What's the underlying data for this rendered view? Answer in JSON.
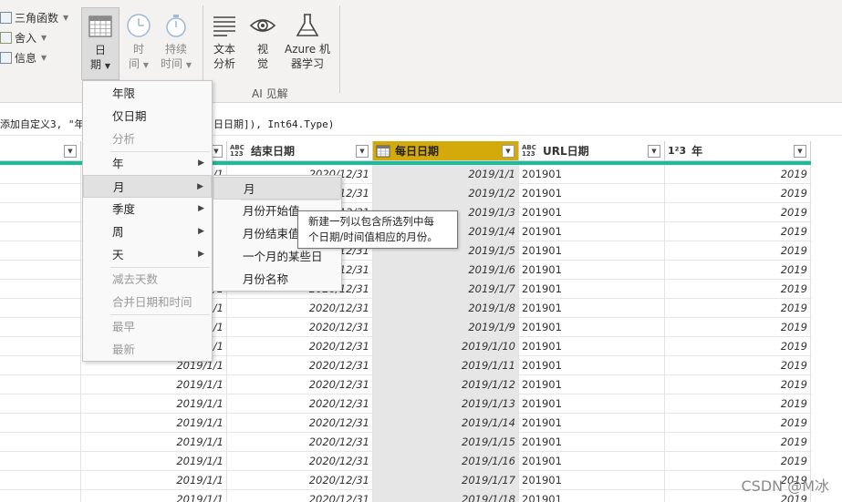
{
  "ribbon": {
    "small_buttons": [
      {
        "label": "三角函数",
        "icon": "trig-icon"
      },
      {
        "label": "舍入",
        "icon": "round-icon"
      },
      {
        "label": "信息",
        "icon": "info-icon"
      }
    ],
    "big_buttons": [
      {
        "label1": "日",
        "label2": "期",
        "icon": "calendar-icon",
        "active": true
      },
      {
        "label1": "时",
        "label2": "间",
        "icon": "clock-icon",
        "disabled": true
      },
      {
        "label1": "持续",
        "label2": "时间",
        "icon": "stopwatch-icon",
        "disabled": true
      },
      {
        "label1": "文本",
        "label2": "分析",
        "icon": "text-lines-icon"
      },
      {
        "label1": "视",
        "label2": "觉",
        "icon": "eye-icon"
      },
      {
        "label1": "Azure 机",
        "label2": "器学习",
        "icon": "flask-icon"
      }
    ],
    "group_label": "AI 见解"
  },
  "formula": {
    "part_a": "添加自定义3, \"年",
    "part_b": "日日期]), Int64.Type)"
  },
  "columns": [
    {
      "name": "",
      "type": ""
    },
    {
      "name": "",
      "type": ""
    },
    {
      "name": "结束日期",
      "type": "ABC\n123"
    },
    {
      "name": "每日日期",
      "type": "calendar"
    },
    {
      "name": "URL日期",
      "type": "ABC\n123"
    },
    {
      "name": "年",
      "type": "1²3"
    }
  ],
  "rows": [
    {
      "start": "2019/1/1",
      "end": "2020/12/31",
      "daily": "2019/1/1",
      "url": "201901",
      "year": "2019"
    },
    {
      "start": "2019/1/1",
      "end": "2020/12/31",
      "daily": "2019/1/2",
      "url": "201901",
      "year": "2019"
    },
    {
      "start": "2019/1/1",
      "end": "2020/12/31",
      "daily": "2019/1/3",
      "url": "201901",
      "year": "2019"
    },
    {
      "start": "2019/1/1",
      "end": "2020/12/31",
      "daily": "2019/1/4",
      "url": "201901",
      "year": "2019"
    },
    {
      "start": "2019/1/1",
      "end": "2020/12/31",
      "daily": "2019/1/5",
      "url": "201901",
      "year": "2019"
    },
    {
      "start": "2019/1/1",
      "end": "2020/12/31",
      "daily": "2019/1/6",
      "url": "201901",
      "year": "2019"
    },
    {
      "start": "2019/1/1",
      "end": "2020/12/31",
      "daily": "2019/1/7",
      "url": "201901",
      "year": "2019"
    },
    {
      "start": "2019/1/1",
      "end": "2020/12/31",
      "daily": "2019/1/8",
      "url": "201901",
      "year": "2019"
    },
    {
      "start": "2019/1/1",
      "end": "2020/12/31",
      "daily": "2019/1/9",
      "url": "201901",
      "year": "2019"
    },
    {
      "start": "2019/1/1",
      "end": "2020/12/31",
      "daily": "2019/1/10",
      "url": "201901",
      "year": "2019"
    },
    {
      "start": "2019/1/1",
      "end": "2020/12/31",
      "daily": "2019/1/11",
      "url": "201901",
      "year": "2019"
    },
    {
      "start": "2019/1/1",
      "end": "2020/12/31",
      "daily": "2019/1/12",
      "url": "201901",
      "year": "2019"
    },
    {
      "start": "2019/1/1",
      "end": "2020/12/31",
      "daily": "2019/1/13",
      "url": "201901",
      "year": "2019"
    },
    {
      "start": "2019/1/1",
      "end": "2020/12/31",
      "daily": "2019/1/14",
      "url": "201901",
      "year": "2019"
    },
    {
      "start": "2019/1/1",
      "end": "2020/12/31",
      "daily": "2019/1/15",
      "url": "201901",
      "year": "2019"
    },
    {
      "start": "2019/1/1",
      "end": "2020/12/31",
      "daily": "2019/1/16",
      "url": "201901",
      "year": "2019"
    },
    {
      "start": "2019/1/1",
      "end": "2020/12/31",
      "daily": "2019/1/17",
      "url": "201901",
      "year": "2019"
    },
    {
      "start": "2019/1/1",
      "end": "2020/12/31",
      "daily": "2019/1/18",
      "url": "201901",
      "year": "2019"
    }
  ],
  "date_menu": [
    {
      "label": "年限"
    },
    {
      "label": "仅日期"
    },
    {
      "label": "分析",
      "disabled": true
    },
    {
      "sep": true
    },
    {
      "label": "年",
      "submenu": true
    },
    {
      "label": "月",
      "submenu": true,
      "hover": true
    },
    {
      "label": "季度",
      "submenu": true
    },
    {
      "label": "周",
      "submenu": true
    },
    {
      "label": "天",
      "submenu": true
    },
    {
      "sep": true
    },
    {
      "label": "减去天数",
      "disabled": true
    },
    {
      "label": "合并日期和时间",
      "disabled": true
    },
    {
      "sep": true
    },
    {
      "label": "最早",
      "disabled": true
    },
    {
      "label": "最新",
      "disabled": true
    }
  ],
  "month_submenu": [
    {
      "label": "月",
      "hover": true
    },
    {
      "sep": true
    },
    {
      "label": "月份开始值"
    },
    {
      "label": "月份结束值"
    },
    {
      "label": "一个月的某些日"
    },
    {
      "label": "月份名称"
    }
  ],
  "tooltip": {
    "line1": "新建一列以包含所选列中每",
    "line2": "个日期/时间值相应的月份。"
  },
  "watermark": "CSDN @M冰"
}
